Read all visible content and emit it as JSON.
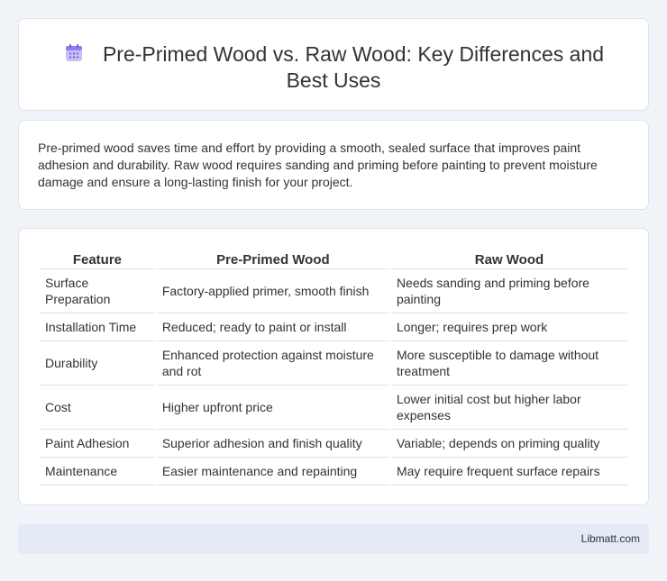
{
  "header": {
    "icon": "calendar-icon",
    "title": "Pre-Primed Wood vs. Raw Wood: Key Differences and Best Uses"
  },
  "intro": {
    "text": "Pre-primed wood saves time and effort by providing a smooth, sealed surface that improves paint adhesion and durability. Raw wood requires sanding and priming before painting to prevent moisture damage and ensure a long-lasting finish for your project."
  },
  "table": {
    "headers": [
      "Feature",
      "Pre-Primed Wood",
      "Raw Wood"
    ],
    "rows": [
      [
        "Surface Preparation",
        "Factory-applied primer, smooth finish",
        "Needs sanding and priming before painting"
      ],
      [
        "Installation Time",
        "Reduced; ready to paint or install",
        "Longer; requires prep work"
      ],
      [
        "Durability",
        "Enhanced protection against moisture and rot",
        "More susceptible to damage without treatment"
      ],
      [
        "Cost",
        "Higher upfront price",
        "Lower initial cost but higher labor expenses"
      ],
      [
        "Paint Adhesion",
        "Superior adhesion and finish quality",
        "Variable; depends on priming quality"
      ],
      [
        "Maintenance",
        "Easier maintenance and repainting",
        "May require frequent surface repairs"
      ]
    ]
  },
  "footer": {
    "brand": "Libmatt.com"
  },
  "colors": {
    "background": "#f0f3f8",
    "footer_bg": "#e4ebf6",
    "icon_accent": "#8e7cf0"
  }
}
